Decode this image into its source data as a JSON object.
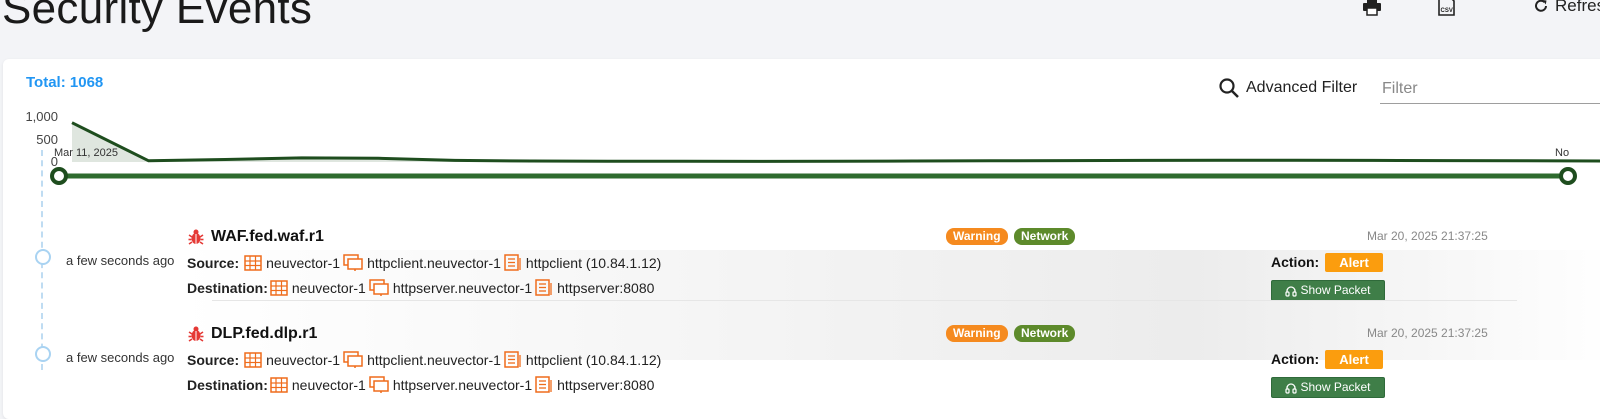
{
  "page": {
    "title": "Security Events"
  },
  "toolbar": {
    "print_icon": "printer-icon",
    "csv_icon": "csv-file-icon",
    "refresh_label": "Refresh"
  },
  "summary": {
    "total_label": "Total:",
    "total_value": "1068"
  },
  "filter": {
    "advanced_label": "Advanced Filter",
    "placeholder": "Filter"
  },
  "chart_data": {
    "type": "area",
    "y_ticks": [
      "1,000",
      "500",
      "0"
    ],
    "start_date_label": "Mar 11, 2025",
    "end_date_label": "No",
    "x": [
      0,
      1,
      2,
      3,
      4,
      5,
      6,
      7,
      8,
      9,
      10,
      11,
      12,
      13,
      14,
      15,
      16,
      17,
      18,
      19,
      20
    ],
    "values": [
      960,
      30,
      60,
      100,
      90,
      40,
      25,
      20,
      18,
      15,
      20,
      25,
      30,
      35,
      40,
      42,
      45,
      40,
      35,
      30,
      25
    ],
    "ylim": [
      0,
      1100
    ],
    "colors": {
      "line": "#1e4d1e",
      "fill": "#dfe6df",
      "slider": "#2e6b2e"
    }
  },
  "events": [
    {
      "ago": "a few seconds ago",
      "title": "WAF.fed.waf.r1",
      "badges": {
        "level": "Warning",
        "type": "Network"
      },
      "timestamp": "Mar 20, 2025 21:37:25",
      "source_label": "Source:",
      "source": {
        "namespace": "neuvector-1",
        "workload": "httpclient.neuvector-1",
        "service": "httpclient (10.84.1.12)"
      },
      "destination_label": "Destination:",
      "destination": {
        "namespace": "neuvector-1",
        "workload": "httpserver.neuvector-1",
        "service": "httpserver:8080"
      },
      "action_label": "Action:",
      "action": "Alert",
      "packet_label": "Show Packet"
    },
    {
      "ago": "a few seconds ago",
      "title": "DLP.fed.dlp.r1",
      "badges": {
        "level": "Warning",
        "type": "Network"
      },
      "timestamp": "Mar 20, 2025 21:37:25",
      "source_label": "Source:",
      "source": {
        "namespace": "neuvector-1",
        "workload": "httpclient.neuvector-1",
        "service": "httpclient (10.84.1.12)"
      },
      "destination_label": "Destination:",
      "destination": {
        "namespace": "neuvector-1",
        "workload": "httpserver.neuvector-1",
        "service": "httpserver:8080"
      },
      "action_label": "Action:",
      "action": "Alert",
      "packet_label": "Show Packet"
    }
  ]
}
